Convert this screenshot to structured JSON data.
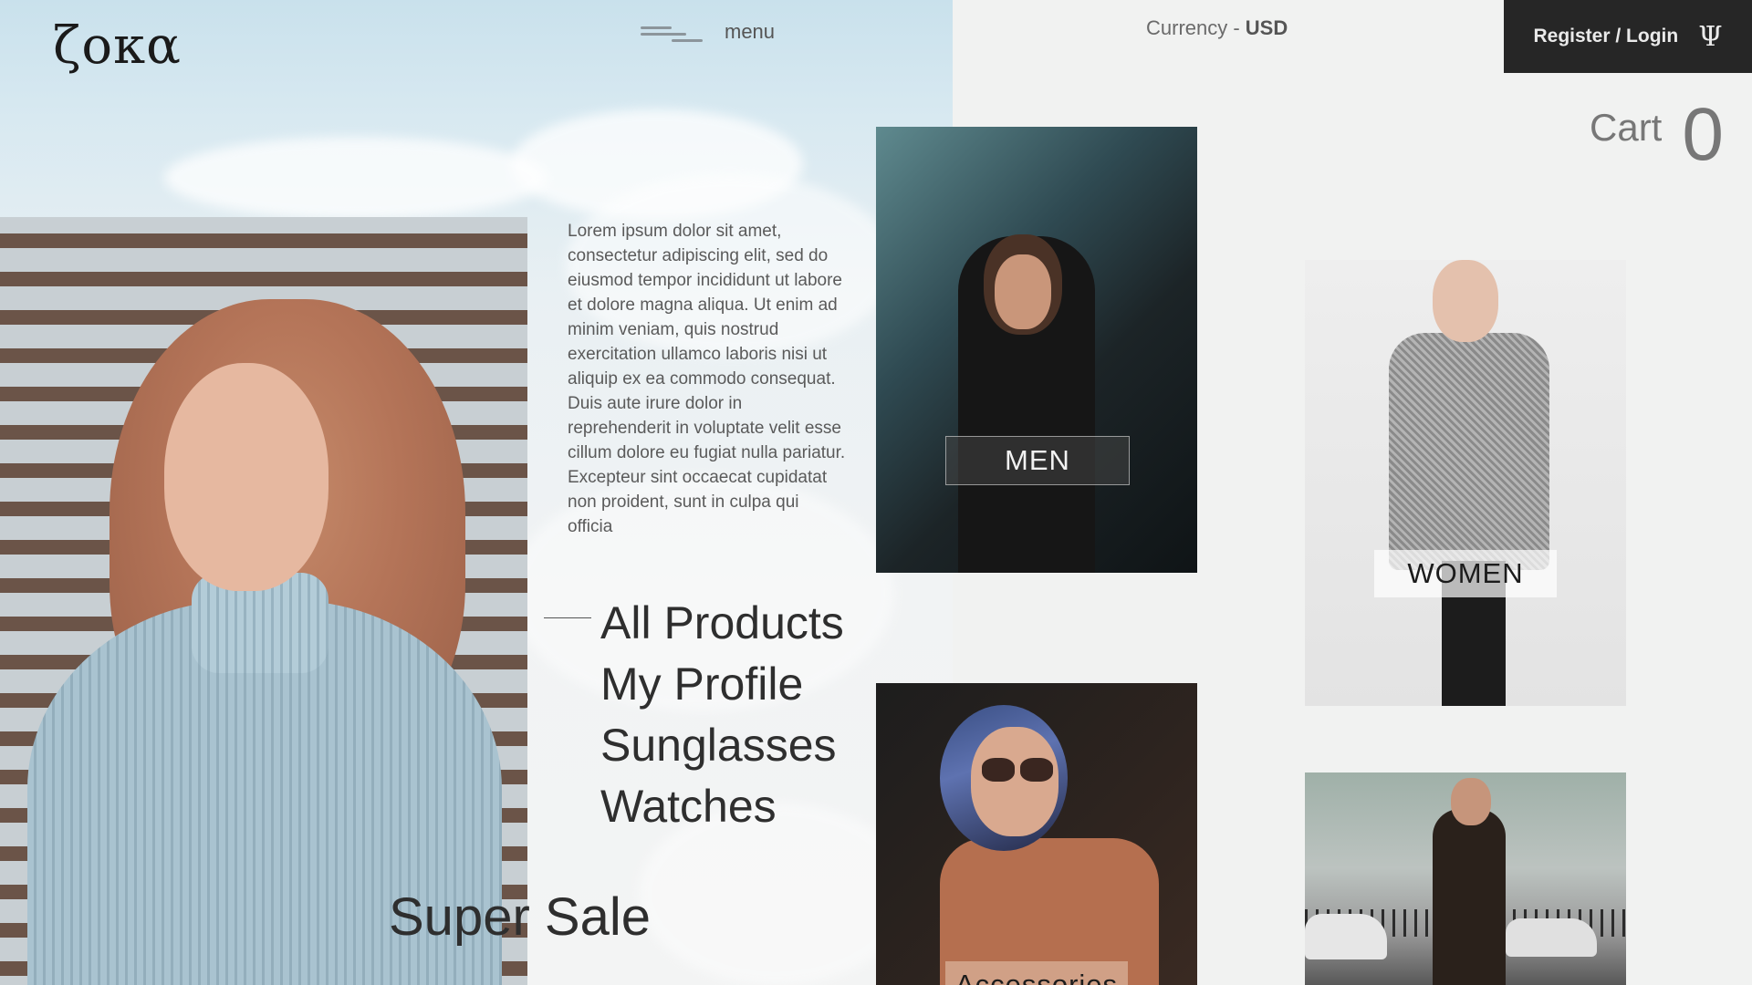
{
  "brand": {
    "logo_text": "ζoκα"
  },
  "header": {
    "menu_label": "menu",
    "currency_label": "Currency - ",
    "currency_value": "USD",
    "login_label": "Register / Login",
    "login_icon": "psi-icon",
    "cart_label": "Cart",
    "cart_count": "0"
  },
  "intro": {
    "body": "Lorem ipsum dolor sit amet, consectetur adipiscing elit, sed do eiusmod tempor incididunt ut labore et dolore magna aliqua. Ut enim ad minim veniam, quis nostrud exercitation ullamco laboris nisi ut aliquip ex ea commodo consequat. Duis aute irure dolor in reprehenderit in voluptate velit esse cillum dolore eu fugiat nulla pariatur. Excepteur sint occaecat cupidatat non proident, sunt in culpa qui officia"
  },
  "nav": {
    "items": [
      {
        "label": "All Products"
      },
      {
        "label": "My Profile"
      },
      {
        "label": "Sunglasses"
      },
      {
        "label": "Watches"
      }
    ]
  },
  "promo": {
    "label": "Super Sale"
  },
  "categories": {
    "men": "MEN",
    "women": "WOMEN",
    "accessories": "Accessories"
  },
  "colors": {
    "login_bg": "#262626",
    "sky": "#c9e1ec",
    "page_bg": "#f1f2f1"
  }
}
